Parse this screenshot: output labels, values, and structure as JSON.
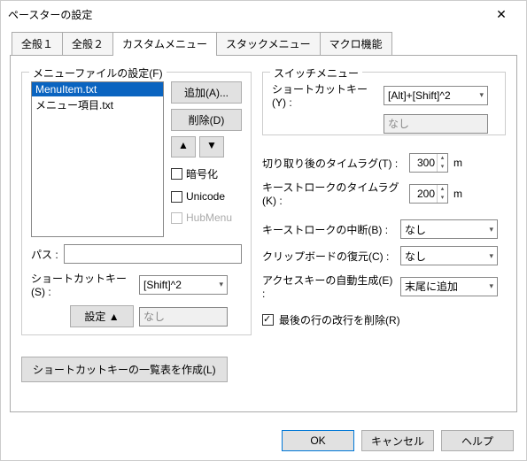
{
  "window": {
    "title": "ペースターの設定"
  },
  "tabs": [
    "全般１",
    "全般２",
    "カスタムメニュー",
    "スタックメニュー",
    "マクロ機能"
  ],
  "left": {
    "group_label": "メニューファイルの設定(F)",
    "files": [
      "MenuItem.txt",
      "メニュー項目.txt"
    ],
    "add_btn": "追加(A)...",
    "del_btn": "削除(D)",
    "chk_encrypt": "暗号化",
    "chk_unicode": "Unicode",
    "chk_hubmenu": "HubMenu",
    "path_label": "パス :",
    "sc_label": "ショートカットキー(S) :",
    "sc_value": "[Shift]^2",
    "settei_btn": "設定 ▲",
    "settei_val": "なし",
    "list_btn": "ショートカットキーの一覧表を作成(L)"
  },
  "right": {
    "group_label": "スイッチメニュー",
    "sc_label": "ショートカットキー(Y) :",
    "sc_value": "[Alt]+[Shift]^2",
    "sc_val2": "なし",
    "cut_lag_label": "切り取り後のタイムラグ(T) :",
    "cut_lag_val": "300",
    "key_lag_label": "キーストロークのタイムラグ(K) :",
    "key_lag_val": "200",
    "unit": "m",
    "interrupt_label": "キーストロークの中断(B) :",
    "interrupt_val": "なし",
    "restore_label": "クリップボードの復元(C) :",
    "restore_val": "なし",
    "access_label": "アクセスキーの自動生成(E) :",
    "access_val": "末尾に追加",
    "lastline_label": "最後の行の改行を削除(R)"
  },
  "footer": {
    "ok": "OK",
    "cancel": "キャンセル",
    "help": "ヘルプ"
  }
}
